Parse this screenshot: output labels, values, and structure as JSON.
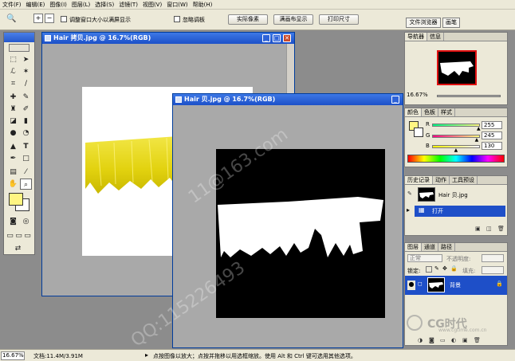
{
  "menu": [
    "文件(F)",
    "编辑(E)",
    "图像(I)",
    "图层(L)",
    "选择(S)",
    "滤镜(T)",
    "视图(V)",
    "窗口(W)",
    "帮助(H)"
  ],
  "options": {
    "resize_windows_label": "调整窗口大小以满屏显示",
    "ignore_palettes_label": "忽略调板",
    "actual_pixels": "实际像素",
    "fit_on_screen": "满画布显示",
    "print_size": "打印尺寸",
    "well_tabs": [
      "文件浏览器",
      "画笔"
    ]
  },
  "doc1": {
    "title": "Hair 拷贝.jpg @ 16.7%(RGB)"
  },
  "doc2": {
    "title": "Hair 贝.jpg @ 16.7%(RGB)"
  },
  "navigator": {
    "tabs": [
      "导航器",
      "信息"
    ],
    "zoom": "16.67%"
  },
  "color_palette": {
    "tabs": [
      "颜色",
      "色板",
      "样式"
    ],
    "channels": [
      {
        "label": "R",
        "value": "255",
        "level": 1.0
      },
      {
        "label": "G",
        "value": "245",
        "level": 0.96
      },
      {
        "label": "B",
        "value": "130",
        "level": 0.51
      }
    ],
    "foreground": "#fff582"
  },
  "history": {
    "tabs": [
      "历史记录",
      "动作",
      "工具预设"
    ],
    "snapshot": "Hair 贝.jpg",
    "state": "打开"
  },
  "layers": {
    "tabs": [
      "图层",
      "通道",
      "路径"
    ],
    "blend_mode": "正常",
    "opacity_label": "不透明度:",
    "lock_label": "锁定:",
    "fill_label": "填充:",
    "layer_name": "背景"
  },
  "status": {
    "zoom": "16.67%",
    "doc_info": "文档:11.4M/3.91M",
    "hint": "点按图像以放大；点按并拖移以用选框缩放。使用 Alt 和 Ctrl 键可选用其他选项。"
  },
  "watermark": {
    "line1": "QQ:115226493",
    "line2": "11@163.com",
    "brand": "CG时代",
    "url": "www.cgtime.com.cn"
  }
}
